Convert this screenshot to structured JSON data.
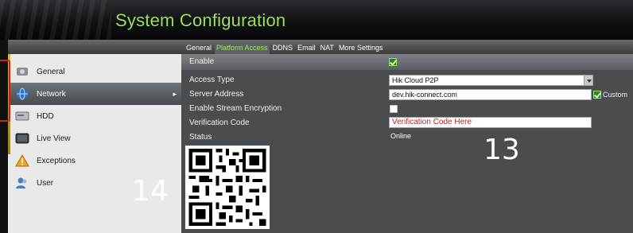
{
  "header": {
    "title": "System Configuration"
  },
  "sidebar": {
    "items": [
      {
        "label": "General",
        "icon": "general-icon"
      },
      {
        "label": "Network",
        "icon": "network-icon",
        "active": true
      },
      {
        "label": "HDD",
        "icon": "hdd-icon"
      },
      {
        "label": "Live View",
        "icon": "live-view-icon"
      },
      {
        "label": "Exceptions",
        "icon": "warning-icon"
      },
      {
        "label": "User",
        "icon": "user-icon"
      }
    ]
  },
  "tabs": [
    "General",
    "Platform Access",
    "DDNS",
    "Email",
    "NAT",
    "More Settings"
  ],
  "active_tab": "Platform Access",
  "form": {
    "enable_label": "Enable",
    "enable_checked": true,
    "access_type_label": "Access Type",
    "access_type_value": "Hik Cloud P2P",
    "server_address_label": "Server Address",
    "server_address_value": "dev.hik-connect.com",
    "custom_label": "Custom",
    "custom_checked": true,
    "stream_encryption_label": "Enable Stream Encryption",
    "stream_encryption_checked": false,
    "verification_code_label": "Verification Code",
    "verification_code_value": "Verification Code Here",
    "status_label": "Status",
    "status_value": "Online"
  },
  "annotations": {
    "left": "14",
    "right": "13"
  },
  "colors": {
    "title": "#9fe05a",
    "active_tab": "#a8e26a",
    "verification_text": "#d21a1a"
  }
}
